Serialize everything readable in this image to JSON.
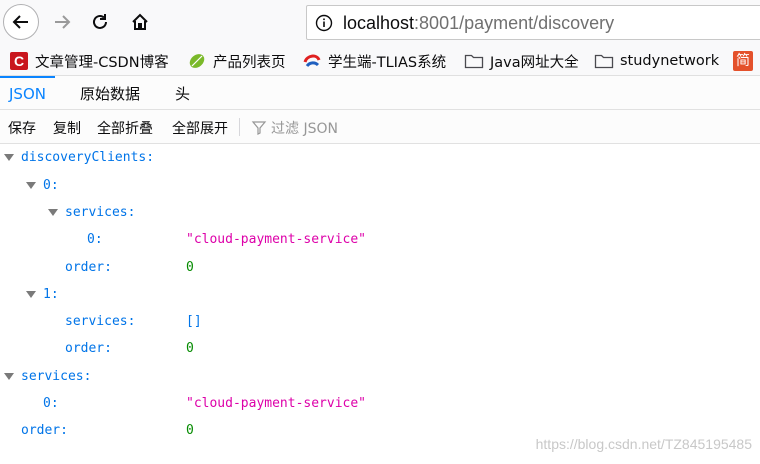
{
  "browser": {
    "url_host": "localhost",
    "url_rest": ":8001/payment/discovery"
  },
  "bookmarks": [
    {
      "label": "文章管理-CSDN博客",
      "icon": "csdn-logo-icon"
    },
    {
      "label": "产品列表页",
      "icon": "leaf-icon"
    },
    {
      "label": "学生端-TLIAS系统",
      "icon": "tlias-logo-icon"
    },
    {
      "label": "Java网址大全",
      "icon": "folder-icon"
    },
    {
      "label": "studynetwork",
      "icon": "folder-icon"
    },
    {
      "label": "简",
      "icon": "jian-badge-icon"
    }
  ],
  "viewer": {
    "tabs": [
      "JSON",
      "原始数据",
      "头"
    ],
    "toolbar": {
      "save": "保存",
      "copy": "复制",
      "collapse_all": "全部折叠",
      "expand_all": "全部展开",
      "filter_placeholder": "过滤 JSON"
    }
  },
  "tree": {
    "discoveryClients_key": "discoveryClients:",
    "c0_key": "0:",
    "c0_services_key": "services:",
    "c0_services_0_key": "0:",
    "c0_services_0_val": "\"cloud-payment-service\"",
    "c0_order_key": "order:",
    "c0_order_val": "0",
    "c1_key": "1:",
    "c1_services_key": "services:",
    "c1_services_val": "[]",
    "c1_order_key": "order:",
    "c1_order_val": "0",
    "services_key": "services:",
    "services_0_key": "0:",
    "services_0_val": "\"cloud-payment-service\"",
    "order_key": "order:",
    "order_val": "0"
  },
  "watermark": "https://blog.csdn.net/TZ845195485",
  "colors": {
    "accent": "#0a84ff",
    "json_key": "#0074e8",
    "json_string": "#dd00a9",
    "json_number": "#058b00"
  }
}
